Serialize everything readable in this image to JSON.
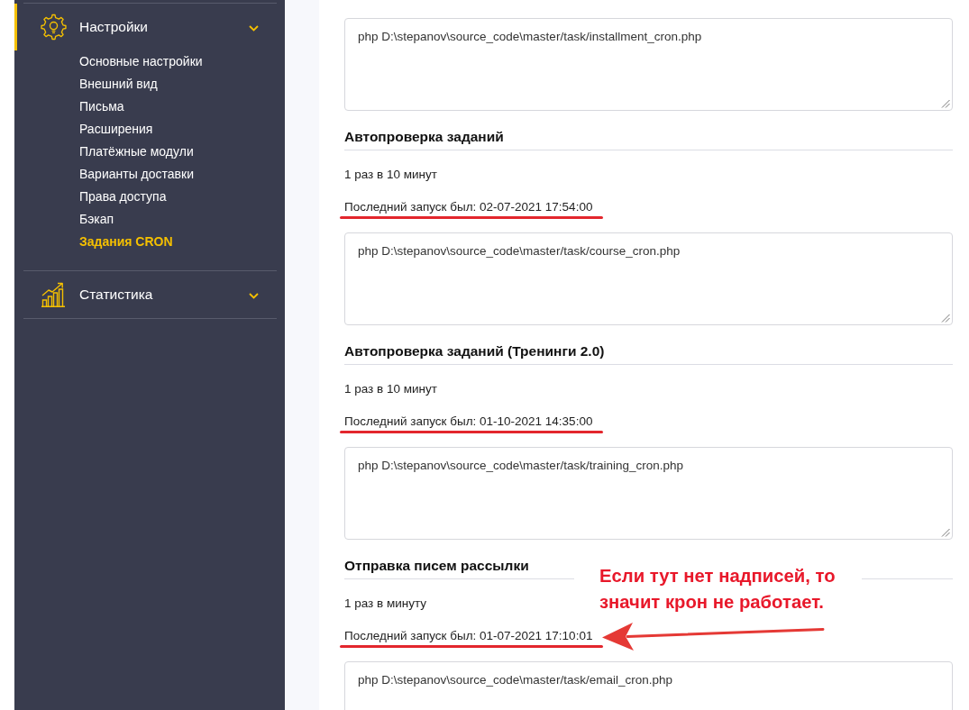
{
  "sidebar": {
    "sections": [
      {
        "label": "Настройки",
        "kind": "settings",
        "selected": true,
        "children": [
          {
            "label": "Основные настройки",
            "selected": false
          },
          {
            "label": "Внешний вид",
            "selected": false
          },
          {
            "label": "Письма",
            "selected": false
          },
          {
            "label": "Расширения",
            "selected": false
          },
          {
            "label": "Платёжные модули",
            "selected": false
          },
          {
            "label": "Варианты доставки",
            "selected": false
          },
          {
            "label": "Права доступа",
            "selected": false
          },
          {
            "label": "Бэкап",
            "selected": false
          },
          {
            "label": "Задания CRON",
            "selected": true
          }
        ]
      },
      {
        "label": "Статистика",
        "kind": "stats",
        "selected": false
      }
    ]
  },
  "tasks": [
    {
      "command": "php D:\\stepanov\\source_code\\master/task/installment_cron.php"
    },
    {
      "title": "Автопроверка заданий",
      "schedule": "1 раз в 10 минут",
      "last_run": "Последний запуск был: 02-07-2021 17:54:00",
      "underlined": true,
      "command": "php D:\\stepanov\\source_code\\master/task/course_cron.php"
    },
    {
      "title": "Автопроверка заданий (Тренинги 2.0)",
      "schedule": "1 раз в 10 минут",
      "last_run": "Последний запуск был: 01-10-2021 14:35:00",
      "underlined": true,
      "command": "php D:\\stepanov\\source_code\\master/task/training_cron.php"
    },
    {
      "title": "Отправка писем рассылки",
      "schedule": "1 раз в минуту",
      "last_run": "Последний запуск был: 01-07-2021 17:10:01",
      "underlined": true,
      "note": "Если тут нет надписей, то значит крон не работает.",
      "command": "php D:\\stepanov\\source_code\\master/task/email_cron.php"
    }
  ]
}
